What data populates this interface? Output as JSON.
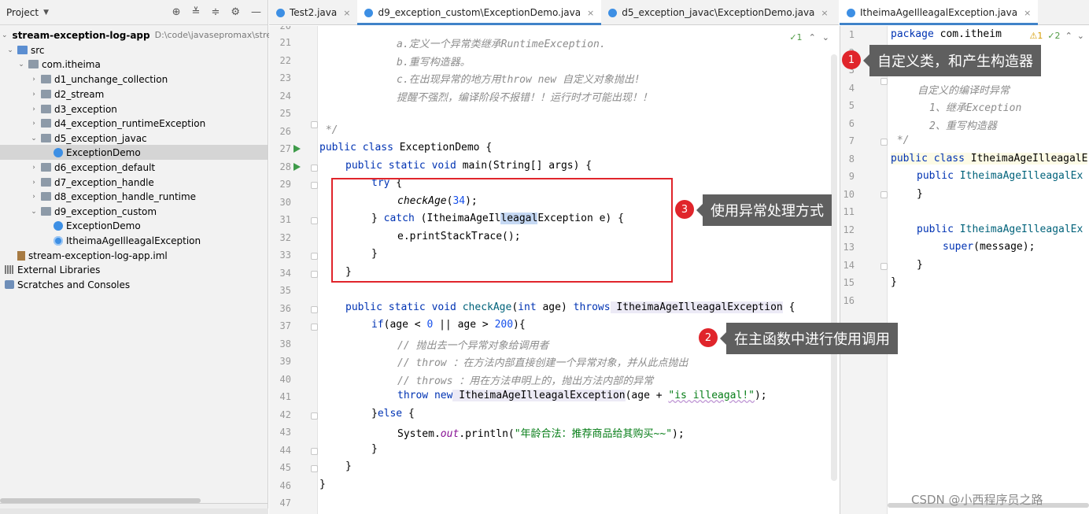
{
  "project": {
    "title": "Project",
    "tree": [
      {
        "label": "stream-exception-log-app",
        "path": "D:\\code\\javasepromax\\stream"
      },
      {
        "label": "src"
      },
      {
        "label": "com.itheima"
      },
      {
        "label": "d1_unchange_collection"
      },
      {
        "label": "d2_stream"
      },
      {
        "label": "d3_exception"
      },
      {
        "label": "d4_exception_runtimeException"
      },
      {
        "label": "d5_exception_javac"
      },
      {
        "label": "ExceptionDemo"
      },
      {
        "label": "d6_exception_default"
      },
      {
        "label": "d7_exception_handle"
      },
      {
        "label": "d8_exception_handle_runtime"
      },
      {
        "label": "d9_exception_custom"
      },
      {
        "label": "ExceptionDemo"
      },
      {
        "label": "ItheimaAgeIlleagalException"
      },
      {
        "label": "stream-exception-log-app.iml"
      },
      {
        "label": "External Libraries"
      },
      {
        "label": "Scratches and Consoles"
      }
    ]
  },
  "tabs": [
    {
      "label": "Test2.java"
    },
    {
      "label": "d9_exception_custom\\ExceptionDemo.java"
    },
    {
      "label": "d5_exception_javac\\ExceptionDemo.java"
    }
  ],
  "right_tab": {
    "label": "ItheimaAgeIlleagalException.java"
  },
  "editor": {
    "inspection": "✓1",
    "line_numbers": [
      "20",
      "21",
      "22",
      "23",
      "24",
      "25",
      "26",
      "27",
      "28",
      "29",
      "30",
      "31",
      "32",
      "33",
      "34",
      "35",
      "36",
      "37",
      "38",
      "39",
      "40",
      "41",
      "42",
      "43",
      "44",
      "45",
      "46",
      "47"
    ],
    "code": {
      "l21": "a.定义一个异常类继承RuntimeException.",
      "l22": "b.重写构造器。",
      "l23": "c.在出现异常的地方用throw new 自定义对象抛出!",
      "l24": "提醒不强烈，编译阶段不报错！！运行时才可能出现！！",
      "l26": " */",
      "l27_kw": "public class",
      "l27_rest": " ExceptionDemo {",
      "l28_kw": "public static void",
      "l28_rest": " main(String[] args) {",
      "l29_kw": "try",
      "l29_rest": " {",
      "l30_fn": "checkAge",
      "l30_num": "34",
      "l31_a": "} ",
      "l31_kw": "catch",
      "l31_b": " (ItheimaAgeIl",
      "l31_sel": "leagal",
      "l31_c": "Exception e) {",
      "l32": "e.printStackTrace();",
      "l33": "}",
      "l34": "}",
      "l36_kw": "public static void",
      "l36_fn": " checkAge",
      "l36_a": "(",
      "l36_kw2": "int",
      "l36_b": " age) ",
      "l36_kw3": "throws",
      "l36_cls": " ItheimaAgeIlleagalException",
      "l36_c": " {",
      "l37_kw": "if",
      "l37_a": "(age < ",
      "l37_n1": "0",
      "l37_b": " || age > ",
      "l37_n2": "200",
      "l37_c": "){",
      "l38": "// 抛出去一个异常对象给调用者",
      "l39": "// throw ：在方法内部直接创建一个异常对象，并从此点抛出",
      "l40": "// throws ：用在方法申明上的，抛出方法内部的异常",
      "l41_kw": "throw new",
      "l41_cls": " ItheimaAgeIlleagalException",
      "l41_a": "(age + ",
      "l41_str": "\"is illeagal!\"",
      "l41_b": ");",
      "l42_a": "}",
      "l42_kw": "else",
      "l42_b": " {",
      "l43_a": "System.",
      "l43_field": "out",
      "l43_b": ".println(",
      "l43_str": "\"年龄合法：推荐商品给其购买~~\"",
      "l43_c": ");",
      "l44": "}",
      "l45": "}",
      "l46": "}"
    }
  },
  "editor_right": {
    "indicators": {
      "warn": "⚠1",
      "ok": "✓2"
    },
    "line_numbers": [
      "1",
      "2",
      "3",
      "4",
      "5",
      "6",
      "7",
      "8",
      "9",
      "10",
      "11",
      "12",
      "13",
      "14",
      "15",
      "16"
    ],
    "code": {
      "r1_kw": "package",
      "r1_rest": " com.itheim",
      "r3": "/**",
      "r4": "自定义的编译时异常",
      "r5": "1、继承Exception",
      "r6": "2、重写构造器",
      "r7": " */",
      "r8_kw": "public class",
      "r8_rest": " ItheimaAgeIlleagalE",
      "r9_kw": "public",
      "r9_rest": " ItheimaAgeIlleagalEx",
      "r10": "}",
      "r12_kw": "public",
      "r12_rest": " ItheimaAgeIlleagalEx",
      "r13_kw": "super",
      "r13_rest": "(message);",
      "r14": "}",
      "r15": "}"
    }
  },
  "annotations": [
    {
      "num": "1",
      "text": "自定义类，和产生构造器"
    },
    {
      "num": "2",
      "text": "在主函数中进行使用调用"
    },
    {
      "num": "3",
      "text": "使用异常处理方式"
    }
  ],
  "watermark": "CSDN @小西程序员之路",
  "colors": {
    "accent": "#4083c9",
    "annotation_red": "#e0252b",
    "callout_bg": "#5f5f5f"
  }
}
